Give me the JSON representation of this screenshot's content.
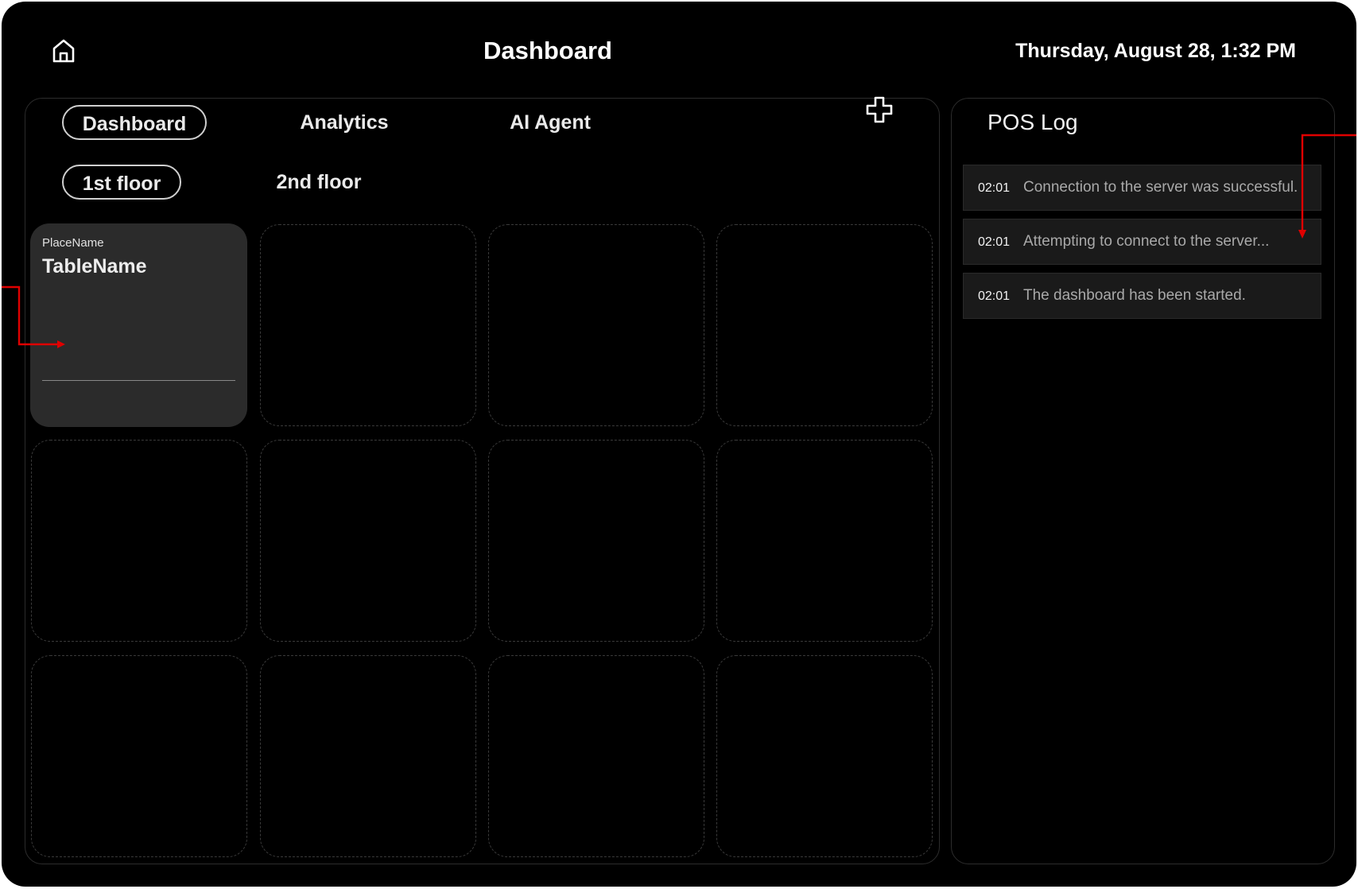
{
  "header": {
    "home_icon": "home-icon",
    "title": "Dashboard",
    "datetime": "Thursday, August 28, 1:32 PM"
  },
  "tabs": [
    {
      "label": "Dashboard",
      "active": true
    },
    {
      "label": "Analytics",
      "active": false
    },
    {
      "label": "AI Agent",
      "active": false
    }
  ],
  "add_icon": "plus-icon",
  "floors": [
    {
      "label": "1st floor",
      "active": true
    },
    {
      "label": "2nd floor",
      "active": false
    }
  ],
  "table_card": {
    "place_name": "PlaceName",
    "table_name": "TableName"
  },
  "pos_log": {
    "title": "POS Log",
    "entries": [
      {
        "time": "02:01",
        "message": "Connection to the server was successful."
      },
      {
        "time": "02:01",
        "message": "Attempting to connect to the server..."
      },
      {
        "time": "02:01",
        "message": "The dashboard has been started."
      }
    ]
  },
  "colors": {
    "background": "#000000",
    "card": "#2b2b2b",
    "annotation_arrow": "#e00000"
  }
}
